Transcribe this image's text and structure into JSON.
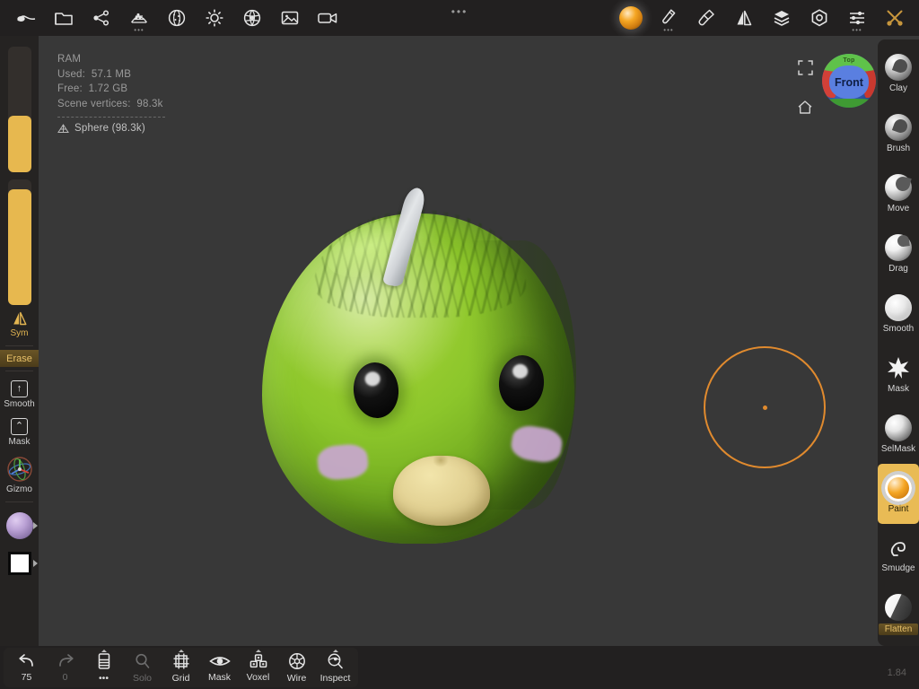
{
  "app": {
    "version": "1.84"
  },
  "topbar": {
    "dots": "•••",
    "left_items": [
      {
        "name": "sculpt-logo",
        "label": "",
        "icon": "sculpt-logo-icon",
        "sub": ""
      },
      {
        "name": "open-file",
        "label": "",
        "icon": "folder-icon",
        "sub": ""
      },
      {
        "name": "share",
        "label": "",
        "icon": "share-nodes-icon",
        "sub": ""
      },
      {
        "name": "primitives",
        "label": "",
        "icon": "primitives-icon",
        "sub": "•••"
      },
      {
        "name": "matcap",
        "label": "",
        "icon": "matcap-sphere-icon",
        "sub": ""
      },
      {
        "name": "lighting",
        "label": "",
        "icon": "sun-icon",
        "sub": ""
      },
      {
        "name": "environment",
        "label": "",
        "icon": "aperture-icon",
        "sub": ""
      },
      {
        "name": "background-image",
        "label": "",
        "icon": "image-icon",
        "sub": ""
      },
      {
        "name": "record-video",
        "label": "",
        "icon": "video-camera-icon",
        "sub": ""
      }
    ],
    "right_items": [
      {
        "name": "material-ball",
        "label": "",
        "icon": "material-sphere-icon",
        "sub": ""
      },
      {
        "name": "brush-settings",
        "label": "",
        "icon": "paintbrush-icon",
        "sub": "•••"
      },
      {
        "name": "stroke-settings",
        "label": "",
        "icon": "stroke-brush-icon",
        "sub": ""
      },
      {
        "name": "symmetry",
        "label": "",
        "icon": "mirror-icon",
        "sub": ""
      },
      {
        "name": "layers",
        "label": "",
        "icon": "layers-stack-icon",
        "sub": ""
      },
      {
        "name": "scene-settings",
        "label": "",
        "icon": "gear-hex-icon",
        "sub": ""
      },
      {
        "name": "sliders",
        "label": "",
        "icon": "sliders-icon",
        "sub": "•••"
      },
      {
        "name": "tools",
        "label": "",
        "icon": "wrench-screwdriver-icon",
        "sub": ""
      }
    ]
  },
  "stats": {
    "ram_title": "RAM",
    "used_label": "Used:",
    "used_value": "57.1 MB",
    "free_label": "Free:",
    "free_value": "1.72 GB",
    "vertices_label": "Scene vertices:",
    "vertices_value": "98.3k",
    "object_name": "Sphere (98.3k)"
  },
  "nav": {
    "fullscreen": "fullscreen-icon",
    "home": "home-icon",
    "view_cube": {
      "front_label": "Front",
      "top_label": "Top",
      "front_color": "#5a7fe0",
      "top_color": "#5fc24a",
      "side_color": "#d24038"
    }
  },
  "left_sidebar": {
    "radius_slider": {
      "name": "radius-slider",
      "fill_percent": 45
    },
    "intensity_slider": {
      "name": "intensity-slider",
      "fill_percent": 92
    },
    "symmetry": {
      "label": "Sym",
      "icon": "mirror-icon",
      "active": true
    },
    "erase": {
      "label": "Erase"
    },
    "smooth": {
      "label": "Smooth",
      "icon": "arrow-up-box-icon"
    },
    "mask": {
      "label": "Mask",
      "icon": "arrow-up-box-icon"
    },
    "gizmo": {
      "label": "Gizmo",
      "icon": "gizmo-axes-icon"
    },
    "material_preview": {
      "name": "material-preview",
      "color": "#b9a0d4"
    },
    "color_swatch": {
      "name": "color-swatch",
      "color": "#ffffff"
    }
  },
  "right_sidebar": {
    "brushes": [
      {
        "label": "Clay",
        "icon": "clay-brush-icon",
        "selected": false
      },
      {
        "label": "Brush",
        "icon": "standard-brush-icon",
        "selected": false
      },
      {
        "label": "Move",
        "icon": "move-brush-icon",
        "selected": false
      },
      {
        "label": "Drag",
        "icon": "drag-brush-icon",
        "selected": false
      },
      {
        "label": "Smooth",
        "icon": "smooth-brush-icon",
        "selected": false
      },
      {
        "label": "Mask",
        "icon": "mask-brush-icon",
        "selected": false
      },
      {
        "label": "SelMask",
        "icon": "selmask-brush-icon",
        "selected": false
      },
      {
        "label": "Paint",
        "icon": "paint-brush-icon",
        "selected": true
      },
      {
        "label": "Smudge",
        "icon": "smudge-brush-icon",
        "selected": false
      },
      {
        "label": "Flatten",
        "icon": "flatten-brush-icon",
        "selected": false
      }
    ],
    "accent_color": "#e9bb55"
  },
  "bottombar": {
    "items": [
      {
        "name": "undo-button",
        "label": "75",
        "icon": "undo-arrow-icon",
        "dim": false,
        "tick": false
      },
      {
        "name": "redo-button",
        "label": "0",
        "icon": "redo-arrow-icon",
        "dim": true,
        "tick": false
      },
      {
        "name": "layers-button",
        "label": "•••",
        "icon": "layers-list-icon",
        "dim": false,
        "tick": true
      },
      {
        "name": "solo-button",
        "label": "Solo",
        "icon": "magnifier-icon",
        "dim": true,
        "tick": false
      },
      {
        "name": "grid-button",
        "label": "Grid",
        "icon": "grid-frame-icon",
        "dim": false,
        "tick": true
      },
      {
        "name": "mask-button",
        "label": "Mask",
        "icon": "eye-icon",
        "dim": false,
        "tick": false
      },
      {
        "name": "voxel-button",
        "label": "Voxel",
        "icon": "voxel-blocks-icon",
        "dim": false,
        "tick": true
      },
      {
        "name": "wire-button",
        "label": "Wire",
        "icon": "wireframe-sphere-icon",
        "dim": false,
        "tick": false
      },
      {
        "name": "inspect-button",
        "label": "Inspect",
        "icon": "inspect-icon",
        "dim": false,
        "tick": true
      }
    ]
  },
  "viewport": {
    "brush_cursor": {
      "color": "#e08a2e",
      "radius_px": 68
    },
    "background_color": "#383838",
    "model_name": "Sphere"
  }
}
